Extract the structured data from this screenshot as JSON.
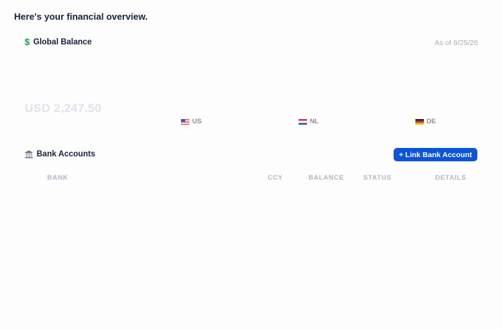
{
  "header": {
    "greeting": "Here's your financial overview."
  },
  "global_balance": {
    "title": "Global Balance",
    "icon": "dollar-sign-icon",
    "as_of": "As of 6/25/26",
    "total": "USD 2,247.50",
    "regions": [
      {
        "code": "US",
        "flag": "us-flag-icon"
      },
      {
        "code": "NL",
        "flag": "nl-flag-icon"
      },
      {
        "code": "DE",
        "flag": "de-flag-icon"
      }
    ]
  },
  "bank_accounts": {
    "title": "Bank Accounts",
    "icon": "bank-icon",
    "link_button_label": "+ Link Bank Account",
    "columns": [
      "BANK",
      "CCY",
      "BALANCE",
      "STATUS",
      "DETAILS"
    ],
    "rows": []
  },
  "colors": {
    "accent": "#0b53d8",
    "heading": "#16213f",
    "muted": "#a9afbb",
    "faded_balance": "#dfe3ea"
  }
}
